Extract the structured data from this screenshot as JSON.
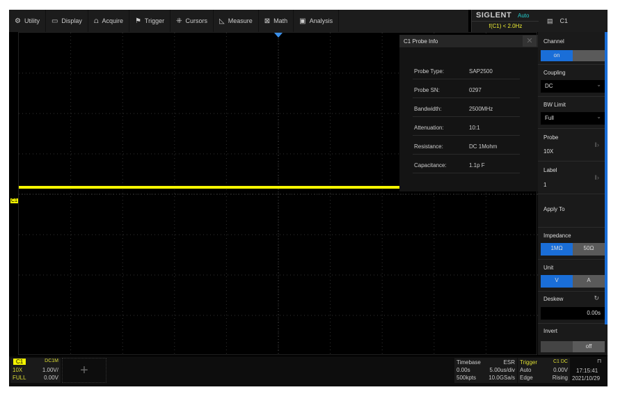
{
  "menu": [
    {
      "icon": "gear-icon",
      "glyph": "⚙",
      "label": "Utility"
    },
    {
      "icon": "display-icon",
      "glyph": "▭",
      "label": "Display"
    },
    {
      "icon": "acquire-icon",
      "glyph": "⩍",
      "label": "Acquire"
    },
    {
      "icon": "flag-icon",
      "glyph": "⚑",
      "label": "Trigger"
    },
    {
      "icon": "cursors-icon",
      "glyph": "⁜",
      "label": "Cursors"
    },
    {
      "icon": "measure-icon",
      "glyph": "◺",
      "label": "Measure"
    },
    {
      "icon": "math-icon",
      "glyph": "⊠",
      "label": "Math"
    },
    {
      "icon": "analysis-icon",
      "glyph": "▣",
      "label": "Analysis"
    }
  ],
  "brand": {
    "logo": "SIGLENT",
    "mode": "Auto",
    "freq": "f(C1) < 2.0Hz"
  },
  "channel_header": "C1",
  "probe_info": {
    "title": "C1 Probe Info",
    "rows": [
      {
        "k": "Probe Type:",
        "v": "SAP2500"
      },
      {
        "k": "Probe SN:",
        "v": "0297"
      },
      {
        "k": "Bandwidth:",
        "v": "2500MHz"
      },
      {
        "k": "Attenuation:",
        "v": "10:1"
      },
      {
        "k": "Resistance:",
        "v": "DC 1Mohm"
      },
      {
        "k": "Capacitance:",
        "v": "1.1p F"
      }
    ]
  },
  "panel": {
    "channel": {
      "label": "Channel",
      "value": "on"
    },
    "coupling": {
      "label": "Coupling",
      "value": "DC"
    },
    "bw": {
      "label": "BW Limit",
      "value": "Full"
    },
    "probe": {
      "label": "Probe",
      "value": "10X"
    },
    "label": {
      "label": "Label",
      "value": "1"
    },
    "apply": "Apply To",
    "impedance": {
      "label": "Impedance",
      "opt1": "1MΩ",
      "opt2": "50Ω"
    },
    "unit": {
      "label": "Unit",
      "opt1": "V",
      "opt2": "A"
    },
    "deskew": {
      "label": "Deskew",
      "value": "0.00s"
    },
    "invert": {
      "label": "Invert",
      "value": "off"
    }
  },
  "trace_marker": "C1",
  "bottom": {
    "ch": {
      "name": "C1",
      "coupling": "DC1M",
      "probe": "10X",
      "scale": "1.00V/",
      "bw": "FULL",
      "offset": "0.00V"
    },
    "timebase": {
      "label": "Timebase",
      "mode": "ESR",
      "delay": "0.00s",
      "scale": "5.00us/div",
      "points": "500kpts",
      "rate": "10.0GSa/s"
    },
    "trigger": {
      "label": "Trigger",
      "src": "C1 DC",
      "mode": "Auto",
      "level": "0.00V",
      "type": "Edge",
      "slope": "Rising"
    },
    "time": "17:15:41",
    "date": "2021/10/29"
  },
  "colors": {
    "trace": "#f5f500",
    "accent": "#1a6ed8"
  }
}
